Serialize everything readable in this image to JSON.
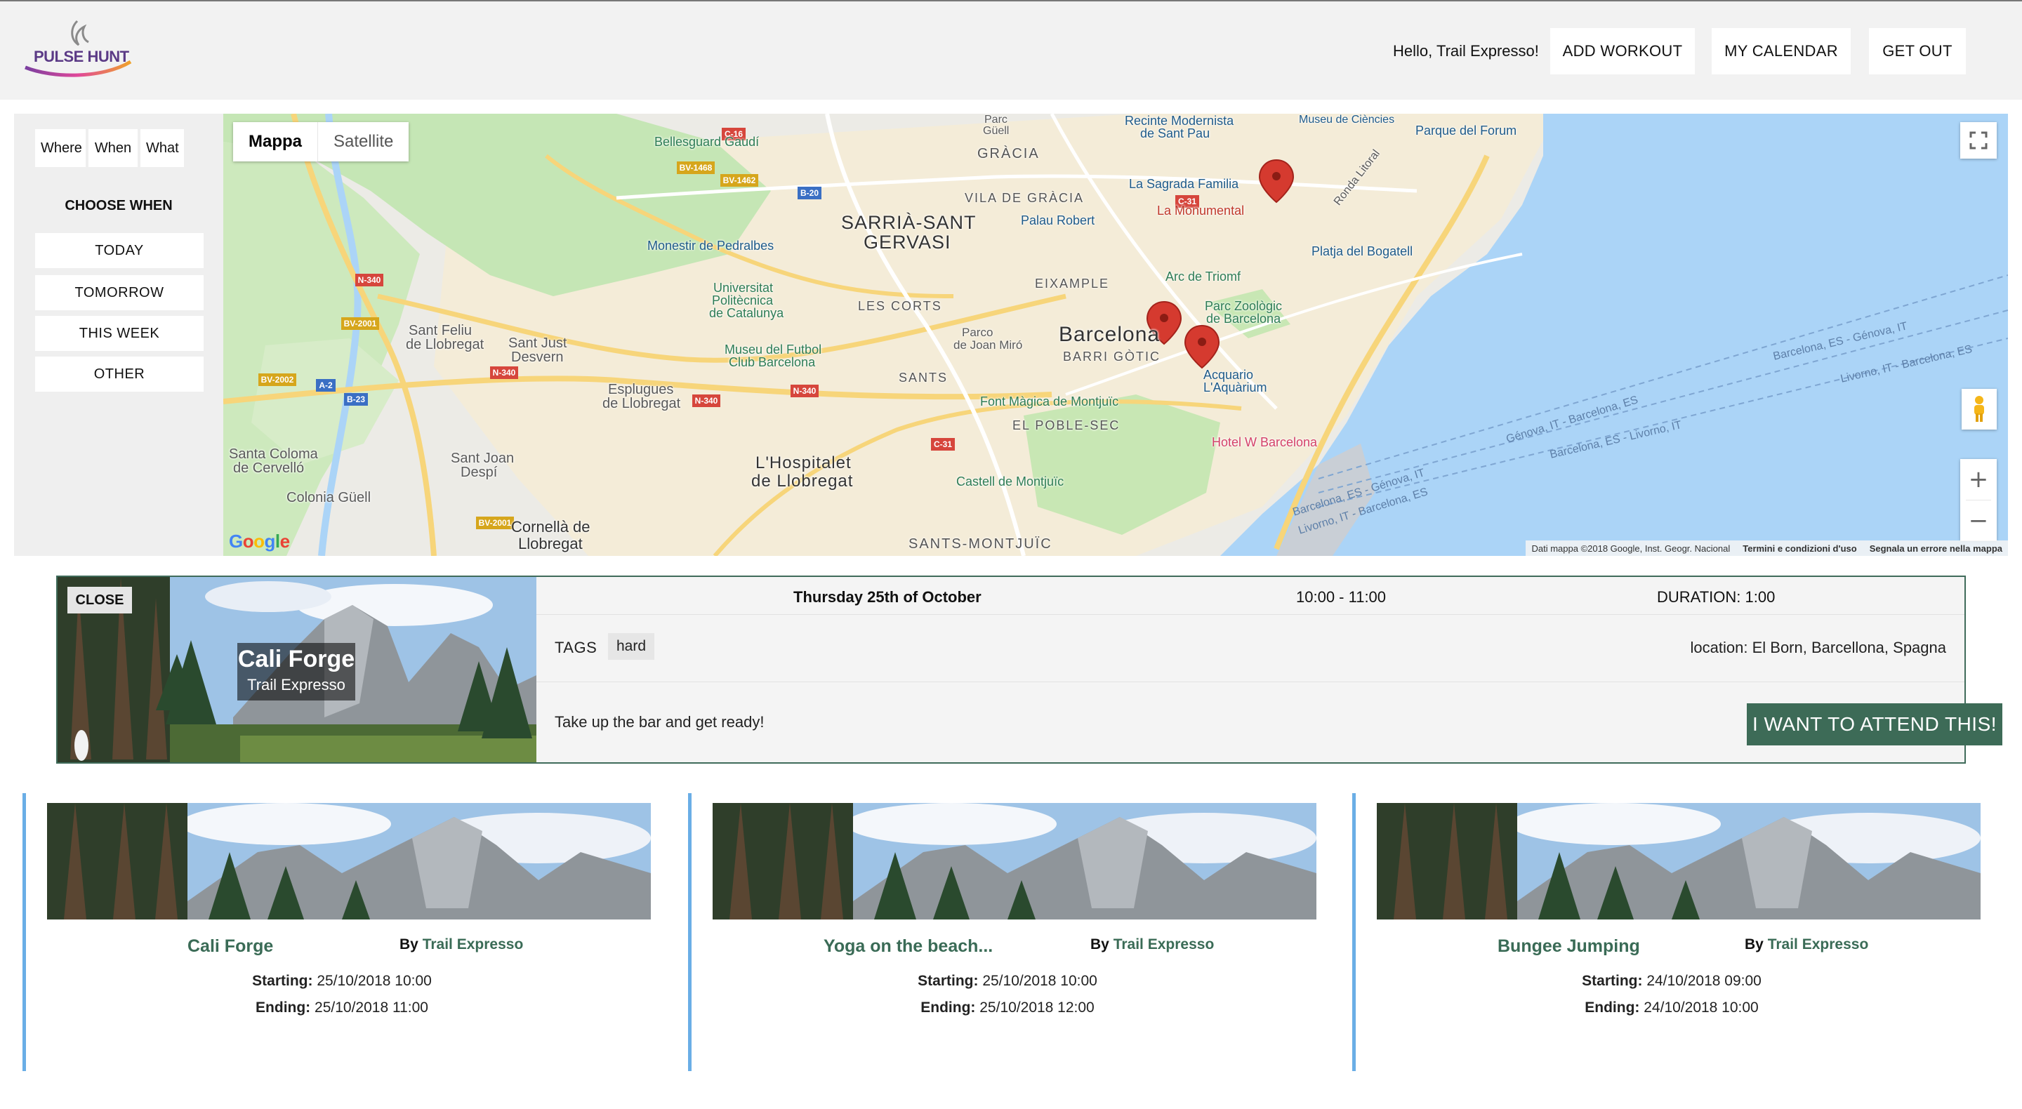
{
  "header": {
    "logo_text": "PULSE HUNT",
    "greeting": "Hello, Trail Expresso!",
    "buttons": {
      "add_workout": "ADD WORKOUT",
      "my_calendar": "MY CALENDAR",
      "get_out": "GET OUT"
    }
  },
  "filters": {
    "tabs": [
      "Where",
      "When",
      "What"
    ],
    "title": "CHOOSE WHEN",
    "options": [
      "TODAY",
      "TOMORROW",
      "THIS WEEK",
      "OTHER"
    ]
  },
  "map": {
    "type_buttons": [
      "Mappa",
      "Satellite"
    ],
    "active_type": "Mappa",
    "google_logo": "Google",
    "attribution": [
      "Dati mappa ©2018 Google, Inst. Geogr. Nacional",
      "Termini e condizioni d'uso",
      "Segnala un errore nella mappa"
    ],
    "labels": {
      "gracia": "GRÀCIA",
      "vila_gracia": "VILA DE GRÀCIA",
      "sarria": "SARRIÀ-SANT",
      "gervasi": "GERVASI",
      "eixample": "EIXAMPLE",
      "les_corts": "LES CORTS",
      "sants": "SANTS",
      "barcelona": "Barcelona",
      "barri_gotic": "BARRI GÒTIC",
      "poble_sec": "EL POBLE-SEC",
      "sants_montjuic": "SANTS-MONTJUÏC",
      "hospitalet_1": "L'Hospitalet",
      "hospitalet_2": "de Llobregat",
      "cornella_1": "Cornellà de",
      "cornella_2": "Llobregat",
      "esplugues_1": "Esplugues",
      "esplugues_2": "de Llobregat",
      "sant_feliu_1": "Sant Feliu",
      "sant_feliu_2": "de Llobregat",
      "sant_just_1": "Sant Just",
      "sant_just_2": "Desvern",
      "santa_coloma_1": "Santa Coloma",
      "santa_coloma_2": "de Cervelló",
      "sant_joan_1": "Sant Joan",
      "sant_joan_2": "Despí",
      "colonia_guell": "Colonia Güell",
      "parc_guell_1": "Parc",
      "parc_guell_2": "Güell",
      "bellesguard": "Bellesguard Gaudí",
      "recinte_1": "Recinte Modernista",
      "recinte_2": "de Sant Pau",
      "sagrada": "La Sagrada Familia",
      "monumental": "La Monumental",
      "palau_robert": "Palau Robert",
      "pedralbes": "Monestir de Pedralbes",
      "upc_1": "Universitat",
      "upc_2": "Politècnica",
      "upc_3": "de Catalunya",
      "museu_futbol_1": "Museu del Futbol",
      "museu_futbol_2": "Club Barcelona",
      "parc_miro_1": "Parco",
      "parc_miro_2": "de Joan Miró",
      "font_magica": "Font Màgica de Montjuïc",
      "castell": "Castell de Montjuïc",
      "arc_triomf": "Arc de Triomf",
      "parc_zoo_1": "Parc Zoològic",
      "parc_zoo_2": "de Barcelona",
      "acquario_1": "Acquario",
      "acquario_2": "L'Aquàrium",
      "hotel_w": "Hotel W Barcelona",
      "platja": "Platja del Bogatell",
      "parque_forum": "Parque del Forum",
      "museo_ciencies": "Museu de Ciències",
      "ronda_litoral": "Ronda Litoral",
      "route_1": "Barcelona, ES - Génova, IT",
      "route_2": "Livorno, IT - Barcelona, ES",
      "route_3": "Génova, IT - Barcelona, ES",
      "route_4": "Barcelona, ES - Livorno, IT",
      "route_5": "Barcelona, ES - Génova, IT",
      "route_6": "Livorno, IT - Barcelona, ES"
    },
    "road_shields": [
      "C-16",
      "BV-1468",
      "BV-1462",
      "B-20",
      "C-31",
      "N-340",
      "BV-2001",
      "BV-2002",
      "A-2",
      "B-23"
    ]
  },
  "detail": {
    "close_label": "CLOSE",
    "title": "Cali Forge",
    "author": "Trail Expresso",
    "date": "Thursday 25th of October",
    "time": "10:00 - 11:00",
    "duration": "DURATION: 1:00",
    "tags_label": "TAGS",
    "tags": [
      "hard"
    ],
    "location": "location: El Born, Barcellona, Spagna",
    "description": "Take up the bar and get ready!",
    "attend_label": "I WANT TO ATTEND THIS!"
  },
  "cards": [
    {
      "title": "Cali Forge",
      "by_label": "By",
      "author": "Trail Expresso",
      "starting_label": "Starting:",
      "starting": "25/10/2018 10:00",
      "ending_label": "Ending:",
      "ending": "25/10/2018 11:00"
    },
    {
      "title": "Yoga on the beach...",
      "by_label": "By",
      "author": "Trail Expresso",
      "starting_label": "Starting:",
      "starting": "25/10/2018 10:00",
      "ending_label": "Ending:",
      "ending": "25/10/2018 12:00"
    },
    {
      "title": "Bungee Jumping",
      "by_label": "By",
      "author": "Trail Expresso",
      "starting_label": "Starting:",
      "starting": "24/10/2018 09:00",
      "ending_label": "Ending:",
      "ending": "24/10/2018 10:00"
    }
  ],
  "colors": {
    "accent_green": "#3d6b57",
    "card_border_blue": "#6aaee6",
    "sea": "#abd4f7",
    "park": "#c5e6b5",
    "marker_red": "#d53a2f"
  }
}
